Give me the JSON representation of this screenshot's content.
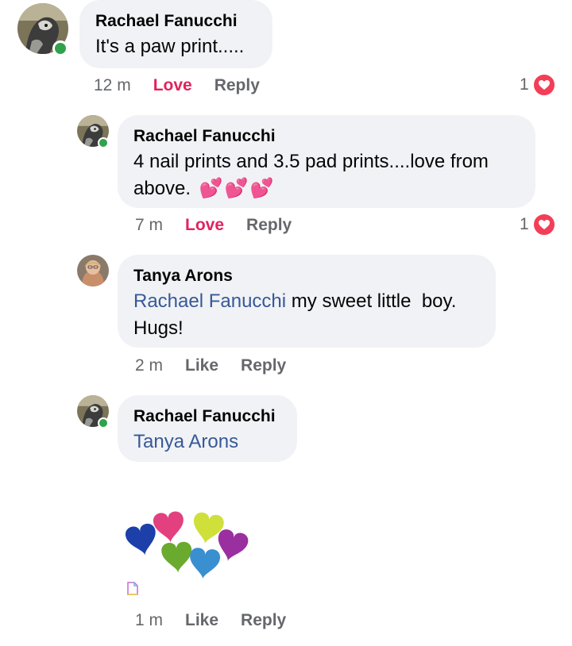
{
  "comments": [
    {
      "author": "Rachael Fanucchi",
      "text": "It's a paw print.....",
      "time": "12 m",
      "action1": "Love",
      "action2": "Reply",
      "reaction_count": "1"
    },
    {
      "author": "Rachael Fanucchi",
      "text_line1": "4 nail prints and 3.5 pad prints....love from",
      "text_line2": "above.",
      "emoji": "💕💕💕",
      "time": "7 m",
      "action1": "Love",
      "action2": "Reply",
      "reaction_count": "1"
    },
    {
      "author": "Tanya Arons",
      "mention": "Rachael Fanucchi",
      "text_line1": " my sweet little  boy.",
      "text_line2": "Hugs!",
      "time": "2 m",
      "action1": "Like",
      "action2": "Reply"
    },
    {
      "author": "Rachael Fanucchi",
      "mention": "Tanya Arons",
      "time": "1 m",
      "action1": "Like",
      "action2": "Reply",
      "sticker": "colorful-hearts-sticker"
    }
  ],
  "colors": {
    "bubble": "#f0f2f5",
    "love": "#e0245e",
    "mention": "#385898",
    "online": "#31a24c",
    "meta": "#65676b"
  }
}
